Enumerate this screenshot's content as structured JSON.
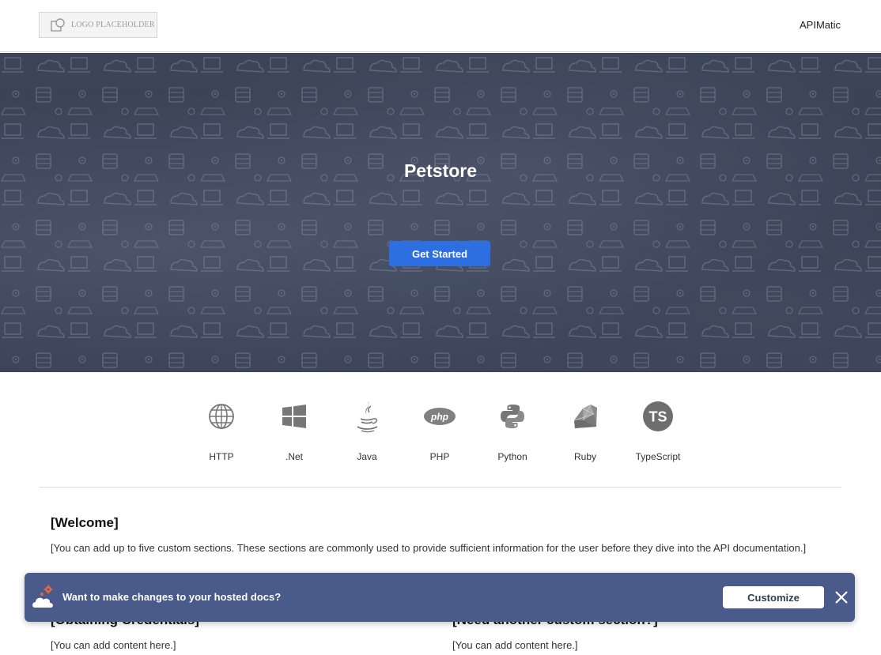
{
  "header": {
    "logo_text": "LOGO PLACEHOLDER",
    "nav_link": "APIMatic"
  },
  "hero": {
    "title": "Petstore",
    "cta_label": "Get Started"
  },
  "languages": [
    {
      "label": "HTTP",
      "icon": "globe-icon"
    },
    {
      "label": ".Net",
      "icon": "windows-icon"
    },
    {
      "label": "Java",
      "icon": "java-icon"
    },
    {
      "label": "PHP",
      "icon": "php-icon"
    },
    {
      "label": "Python",
      "icon": "python-icon"
    },
    {
      "label": "Ruby",
      "icon": "ruby-icon"
    },
    {
      "label": "TypeScript",
      "icon": "typescript-icon"
    }
  ],
  "sections": {
    "welcome_title": "[Welcome]",
    "welcome_text": "[You can add up to five custom sections. These sections are commonly used to provide sufficient information for the user before they dive into the API documentation.]",
    "credentials_title": "[Obtaining Credentials]",
    "credentials_text": "[You can add content here.]",
    "custom_title": "[Need another custom section?]",
    "custom_text": "[You can add content here.]"
  },
  "banner": {
    "message": "Want to make changes to your hosted docs?",
    "button_label": "Customize"
  },
  "colors": {
    "cta": "#2d6fe0",
    "banner_bg": "#4a5a8a",
    "hero_bg": "#3b4257"
  }
}
